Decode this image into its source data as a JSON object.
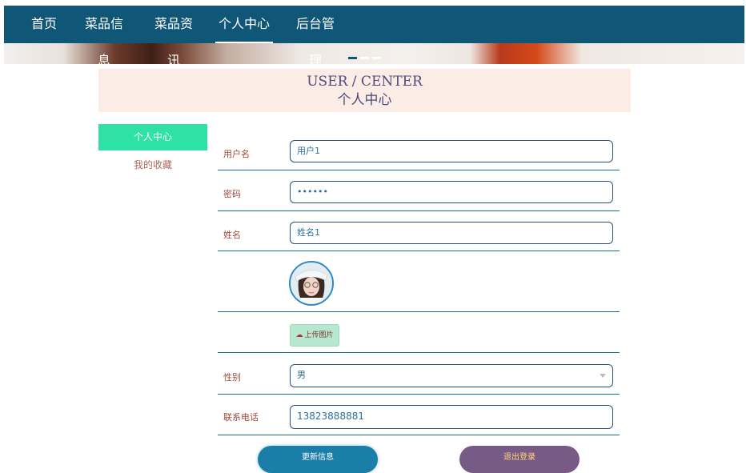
{
  "nav": {
    "items": [
      "首页",
      "菜品信息",
      "菜品资讯",
      "个人中心",
      "后台管理"
    ],
    "active_index": 3
  },
  "banner": {
    "active_dot": 0,
    "dot_count": 3
  },
  "title": {
    "en": "USER / CENTER",
    "cn": "个人中心"
  },
  "sidebar": {
    "items": [
      "个人中心",
      "我的收藏"
    ],
    "active_index": 0
  },
  "form": {
    "username": {
      "label": "用户名",
      "value": "用户1"
    },
    "password": {
      "label": "密码",
      "value": "••••••"
    },
    "name": {
      "label": "姓名",
      "value": "姓名1"
    },
    "upload": {
      "label": "上传图片",
      "icon": "cloud-upload-icon"
    },
    "gender": {
      "label": "性别",
      "value": "男"
    },
    "phone": {
      "label": "联系电话",
      "value": "13823888881"
    }
  },
  "buttons": {
    "update": "更新信息",
    "logout": "退出登录"
  },
  "colors": {
    "nav_bg": "#0f5677",
    "sidebar_active": "#2ee2a6",
    "title_bg": "#fbede6",
    "update_btn": "#1a7ea8",
    "logout_btn": "#785a86"
  }
}
